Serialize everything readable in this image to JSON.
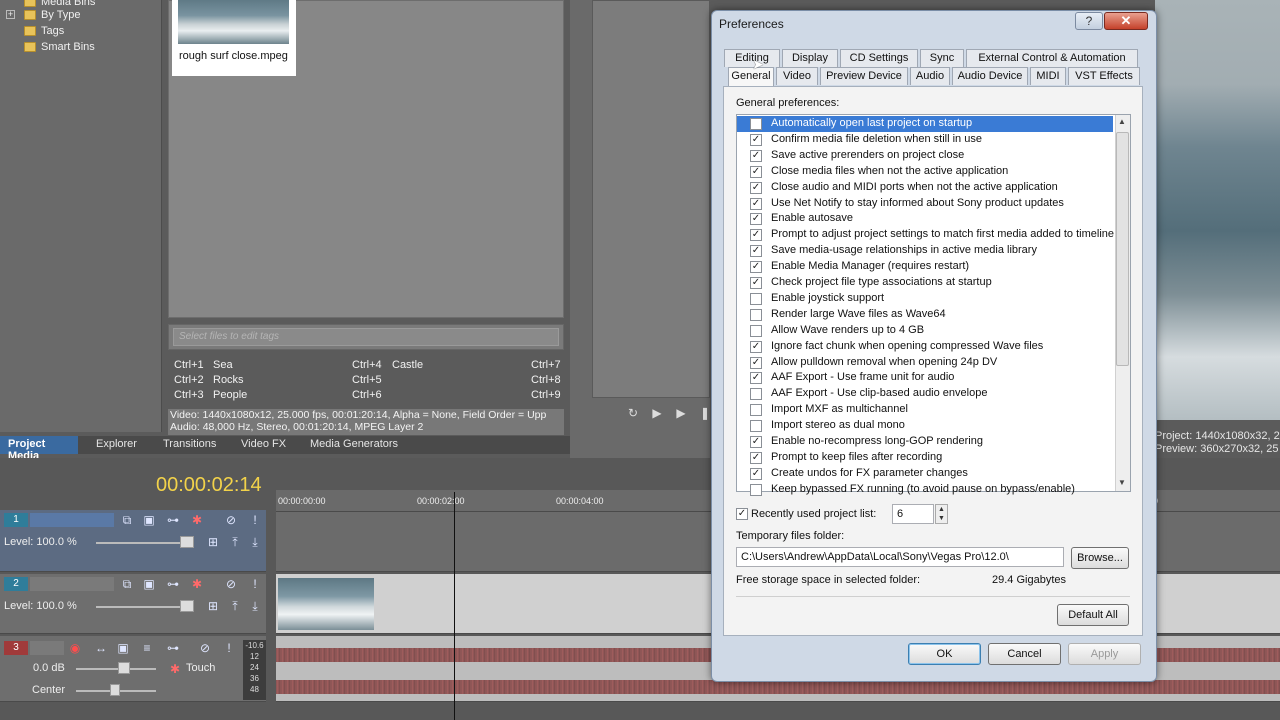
{
  "tree": {
    "items": [
      "Media Bins",
      "By Type",
      "Tags",
      "Smart Bins"
    ]
  },
  "media": {
    "thumb_label": "rough surf close.mpeg",
    "tag_placeholder": "Select files to edit tags",
    "tags": [
      [
        "Ctrl+1",
        "Sea"
      ],
      [
        "Ctrl+2",
        "Rocks"
      ],
      [
        "Ctrl+3",
        "People"
      ],
      [
        "Ctrl+4",
        "Castle"
      ],
      [
        "Ctrl+5",
        ""
      ],
      [
        "Ctrl+6",
        ""
      ],
      [
        "Ctrl+7",
        ""
      ],
      [
        "Ctrl+8",
        ""
      ],
      [
        "Ctrl+9",
        ""
      ]
    ],
    "info_video": "Video: 1440x1080x12, 25.000 fps, 00:01:20:14, Alpha = None, Field Order = Upp",
    "info_audio": "Audio: 48,000 Hz, Stereo, 00:01:20:14, MPEG Layer 2"
  },
  "panel_tabs": [
    "Project Media",
    "Explorer",
    "Transitions",
    "Video FX",
    "Media Generators"
  ],
  "preview_info": [
    "Project: 1440x1080x32, 2",
    "Preview: 360x270x32, 25"
  ],
  "timeline": {
    "timecode": "00:00:02:14",
    "ticks": [
      "00:00:00:00",
      "00:00:02:00",
      "00:00:04:00",
      "0"
    ],
    "tracks": [
      {
        "num": "1",
        "level": "Level: 100.0 %"
      },
      {
        "num": "2",
        "level": "Level: 100.0 %"
      },
      {
        "num": "3",
        "vol": "0.0 dB",
        "pan": "Center",
        "mode": "Touch",
        "meter": [
          "-10.6",
          "12",
          "24",
          "36",
          "48"
        ]
      }
    ]
  },
  "dialog": {
    "title": "Preferences",
    "help_label": "?",
    "close_label": "✕",
    "tabs_row1": [
      "Editing",
      "Display",
      "CD Settings",
      "Sync",
      "External Control & Automation"
    ],
    "tabs_row2": [
      "General",
      "Video",
      "Preview Device",
      "Audio",
      "Audio Device",
      "MIDI",
      "VST Effects"
    ],
    "section_label": "General preferences:",
    "options": [
      {
        "label": "Automatically open last project on startup",
        "checked": false
      },
      {
        "label": "Confirm media file deletion when still in use",
        "checked": true
      },
      {
        "label": "Save active prerenders on project close",
        "checked": true
      },
      {
        "label": "Close media files when not the active application",
        "checked": true
      },
      {
        "label": "Close audio and MIDI ports when not the active application",
        "checked": true
      },
      {
        "label": "Use Net Notify to stay informed about Sony product updates",
        "checked": true
      },
      {
        "label": "Enable autosave",
        "checked": true
      },
      {
        "label": "Prompt to adjust project settings to match first media added to timeline",
        "checked": true
      },
      {
        "label": "Save media-usage relationships in active media library",
        "checked": true
      },
      {
        "label": "Enable Media Manager (requires restart)",
        "checked": true
      },
      {
        "label": "Check project file type associations at startup",
        "checked": true
      },
      {
        "label": "Enable joystick support",
        "checked": false
      },
      {
        "label": "Render large Wave files as Wave64",
        "checked": false
      },
      {
        "label": "Allow Wave renders up to 4 GB",
        "checked": false
      },
      {
        "label": "Ignore fact chunk when opening compressed Wave files",
        "checked": true
      },
      {
        "label": "Allow pulldown removal when opening 24p DV",
        "checked": true
      },
      {
        "label": "AAF Export - Use frame unit for audio",
        "checked": true
      },
      {
        "label": "AAF Export - Use clip-based audio envelope",
        "checked": false
      },
      {
        "label": "Import MXF as multichannel",
        "checked": false
      },
      {
        "label": "Import stereo as dual mono",
        "checked": false
      },
      {
        "label": "Enable no-recompress long-GOP rendering",
        "checked": true
      },
      {
        "label": "Prompt to keep files after recording",
        "checked": true
      },
      {
        "label": "Create undos for FX parameter changes",
        "checked": true
      },
      {
        "label": "Keep bypassed FX running (to avoid pause on bypass/enable)",
        "checked": false
      }
    ],
    "recent_label": "Recently used project list:",
    "recent_value": "6",
    "temp_label": "Temporary files folder:",
    "temp_path": "C:\\Users\\Andrew\\AppData\\Local\\Sony\\Vegas Pro\\12.0\\",
    "browse_label": "Browse...",
    "storage_label": "Free storage space in selected folder:",
    "storage_value": "29.4 Gigabytes",
    "default_all": "Default All",
    "ok": "OK",
    "cancel": "Cancel",
    "apply": "Apply"
  }
}
